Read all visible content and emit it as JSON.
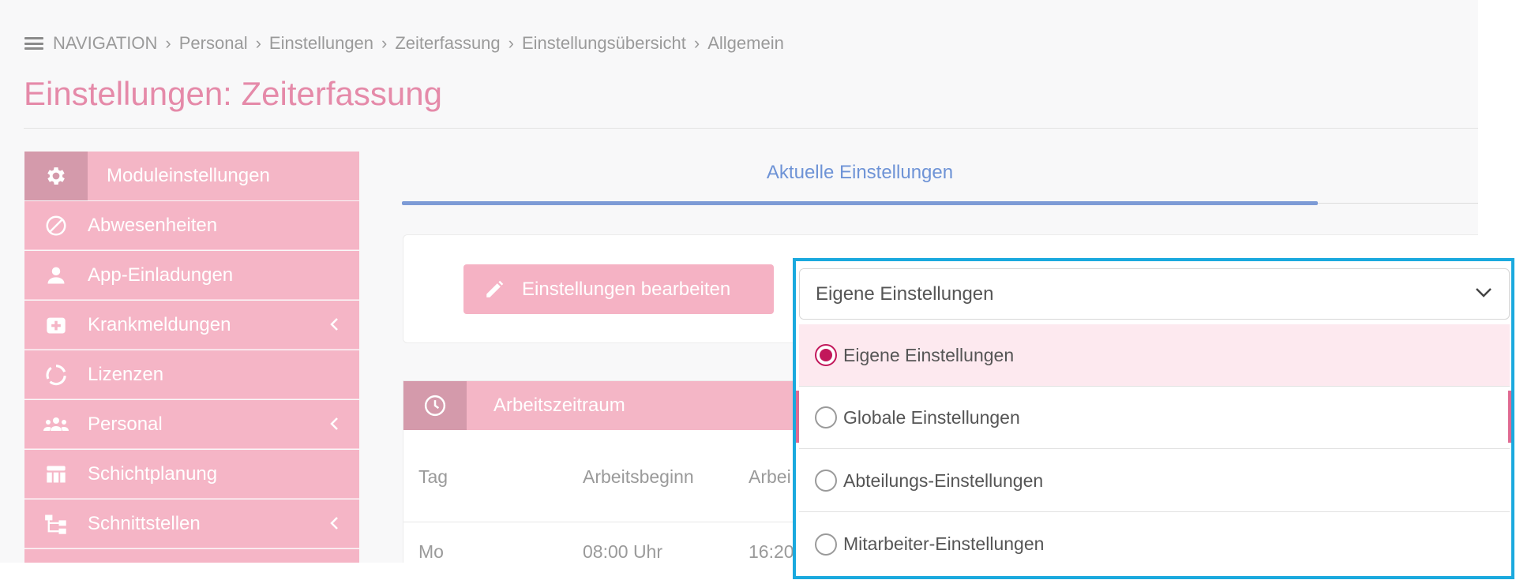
{
  "breadcrumb": {
    "nav_label": "NAVIGATION",
    "items": [
      "Personal",
      "Einstellungen",
      "Zeiterfassung",
      "Einstellungsübersicht",
      "Allgemein"
    ]
  },
  "page_title": "Einstellungen: Zeiterfassung",
  "sidebar": {
    "header": "Moduleinstellungen",
    "items": [
      {
        "label": "Abwesenheiten",
        "icon": "block-icon"
      },
      {
        "label": "App-Einladungen",
        "icon": "person-icon"
      },
      {
        "label": "Krankmeldungen",
        "icon": "medical-plus-icon",
        "expandable": true
      },
      {
        "label": "Lizenzen",
        "icon": "circle-arrows-icon"
      },
      {
        "label": "Personal",
        "icon": "group-icon",
        "expandable": true
      },
      {
        "label": "Schichtplanung",
        "icon": "table-icon"
      },
      {
        "label": "Schnittstellen",
        "icon": "hierarchy-icon",
        "expandable": true
      }
    ]
  },
  "tabs": {
    "active": "Aktuelle Einstellungen"
  },
  "actions": {
    "edit_label": "Einstellungen bearbeiten"
  },
  "scope_select": {
    "value": "Eigene Einstellungen",
    "options": [
      {
        "label": "Eigene Einstellungen",
        "selected": true
      },
      {
        "label": "Globale Einstellungen",
        "selected": false
      },
      {
        "label": "Abteilungs-Einstellungen",
        "selected": false
      },
      {
        "label": "Mitarbeiter-Einstellungen",
        "selected": false
      }
    ]
  },
  "work_period": {
    "title": "Arbeitszeitraum",
    "columns": [
      "Tag",
      "Arbeitsbeginn",
      "Arbei"
    ],
    "rows": [
      {
        "day": "Mo",
        "start": "08:00 Uhr",
        "end": "16:20"
      }
    ]
  },
  "colors": {
    "accent_pink": "#f4b6c6",
    "title_pink": "#e58aa9",
    "tab_blue": "#7d9bd6",
    "highlight_blue": "#1aa9de",
    "radio_selected": "#c2185b"
  }
}
